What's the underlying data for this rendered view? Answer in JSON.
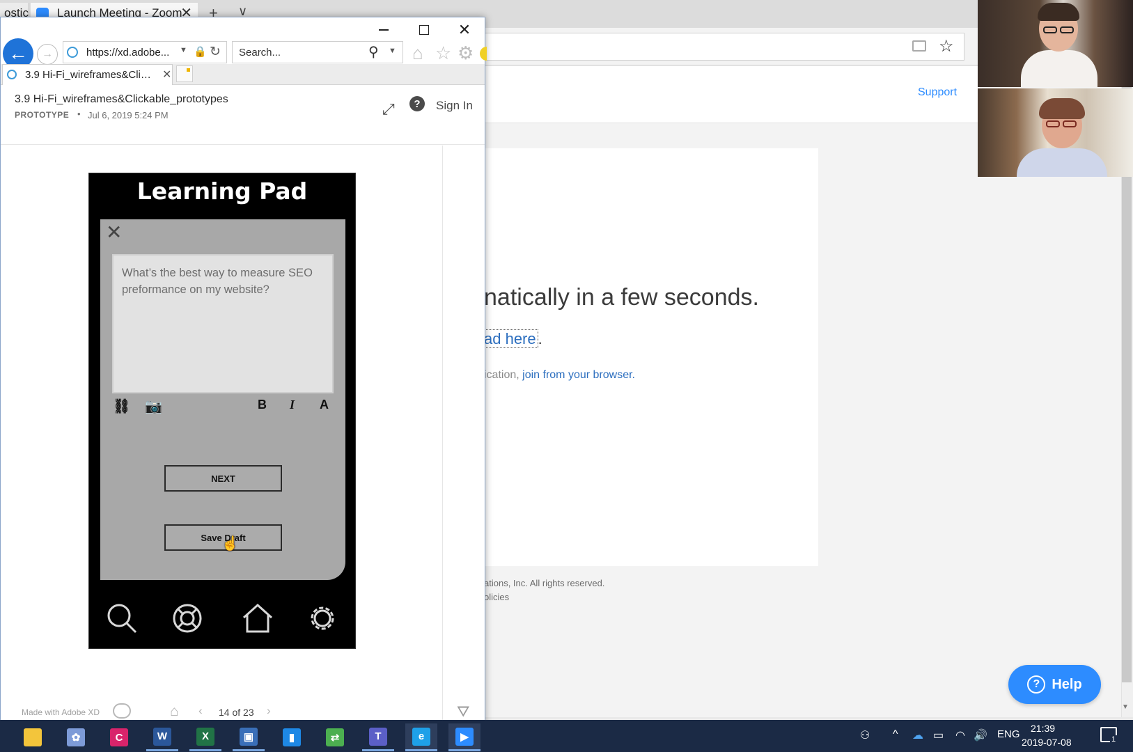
{
  "background_browser": {
    "tabs": [
      {
        "label": "ostic"
      },
      {
        "label": "Launch Meeting - Zoom"
      }
    ],
    "new_tab_glyph": "+",
    "tab_dropdown_glyph": "∨",
    "close_glyph": "✕",
    "star_glyph": "☆"
  },
  "zoom_page": {
    "support_link": "Support",
    "heading": "natically in a few seconds.",
    "download_link": "ad here",
    "download_suffix": ".",
    "join_prefix": "ication, ",
    "join_link": "join from your browser.",
    "copyright": "ations, Inc. All rights reserved.",
    "policies": "olicies",
    "help_button": "Help",
    "help_glyph": "?",
    "brand_color": "#2d8cff"
  },
  "ie_window": {
    "address": "https://xd.adobe...",
    "search_placeholder": "Search...",
    "tab_title": "3.9 Hi-Fi_wireframes&Click...",
    "close_glyph": "✕",
    "back_glyph": "←",
    "forward_glyph": "→",
    "lock_glyph": "🔒",
    "refresh_glyph": "↻",
    "search_glyph": "⚲",
    "dropdown_glyph": "▼",
    "home_glyph": "⌂",
    "favorites_glyph": "☆",
    "tools_glyph": "⚙"
  },
  "xd_viewer": {
    "title": "3.9 Hi-Fi_wireframes&Clickable_prototypes",
    "type": "PROTOTYPE",
    "separator": "•",
    "date": "Jul 6, 2019 5:24 PM",
    "expand_glyph": "⤢",
    "help_glyph": "?",
    "sign_in": "Sign In",
    "made_with": "Made with Adobe XD",
    "home_glyph": "⌂",
    "prev_glyph": "‹",
    "next_glyph": "›",
    "page_count": "14 of 23",
    "comment_glyph": "⛛"
  },
  "prototype": {
    "app_title": "Learning Pad",
    "close_glyph": "✕",
    "question_text": "What’s the best way to measure SEO preformance on my website?",
    "link_glyph": "⛓",
    "camera_glyph": "📷",
    "bold_label": "B",
    "italic_label": "I",
    "font_label": "A",
    "next_button": "NEXT",
    "save_draft_button": "Save Draft",
    "cursor_glyph": "☝"
  },
  "taskbar": {
    "apps": [
      {
        "name": "file-explorer",
        "label": "",
        "color": "#f3c53b"
      },
      {
        "name": "paint",
        "label": "✿",
        "color": "#7d9bd8"
      },
      {
        "name": "app-c",
        "label": "C",
        "color": "#d8246b"
      },
      {
        "name": "word",
        "label": "W",
        "color": "#2b579a"
      },
      {
        "name": "excel",
        "label": "X",
        "color": "#217346"
      },
      {
        "name": "remote-desktop",
        "label": "▣",
        "color": "#3a6fb8"
      },
      {
        "name": "app-book",
        "label": "▮",
        "color": "#1e88e5"
      },
      {
        "name": "network-app",
        "label": "⇄",
        "color": "#4caf50"
      },
      {
        "name": "teams",
        "label": "T",
        "color": "#5b5fc7"
      },
      {
        "name": "internet-explorer",
        "label": "e",
        "color": "#1ea0e8"
      },
      {
        "name": "zoom",
        "label": "▶",
        "color": "#2d8cff"
      }
    ],
    "language": "ENG",
    "time": "21:39",
    "date": "2019-07-08",
    "notification_count": "1",
    "people_glyph": "⚇",
    "chevron_glyph": "^",
    "cloud_glyph": "☁",
    "battery_glyph": "▭",
    "wifi_glyph": "◠",
    "volume_glyph": "🔊"
  }
}
